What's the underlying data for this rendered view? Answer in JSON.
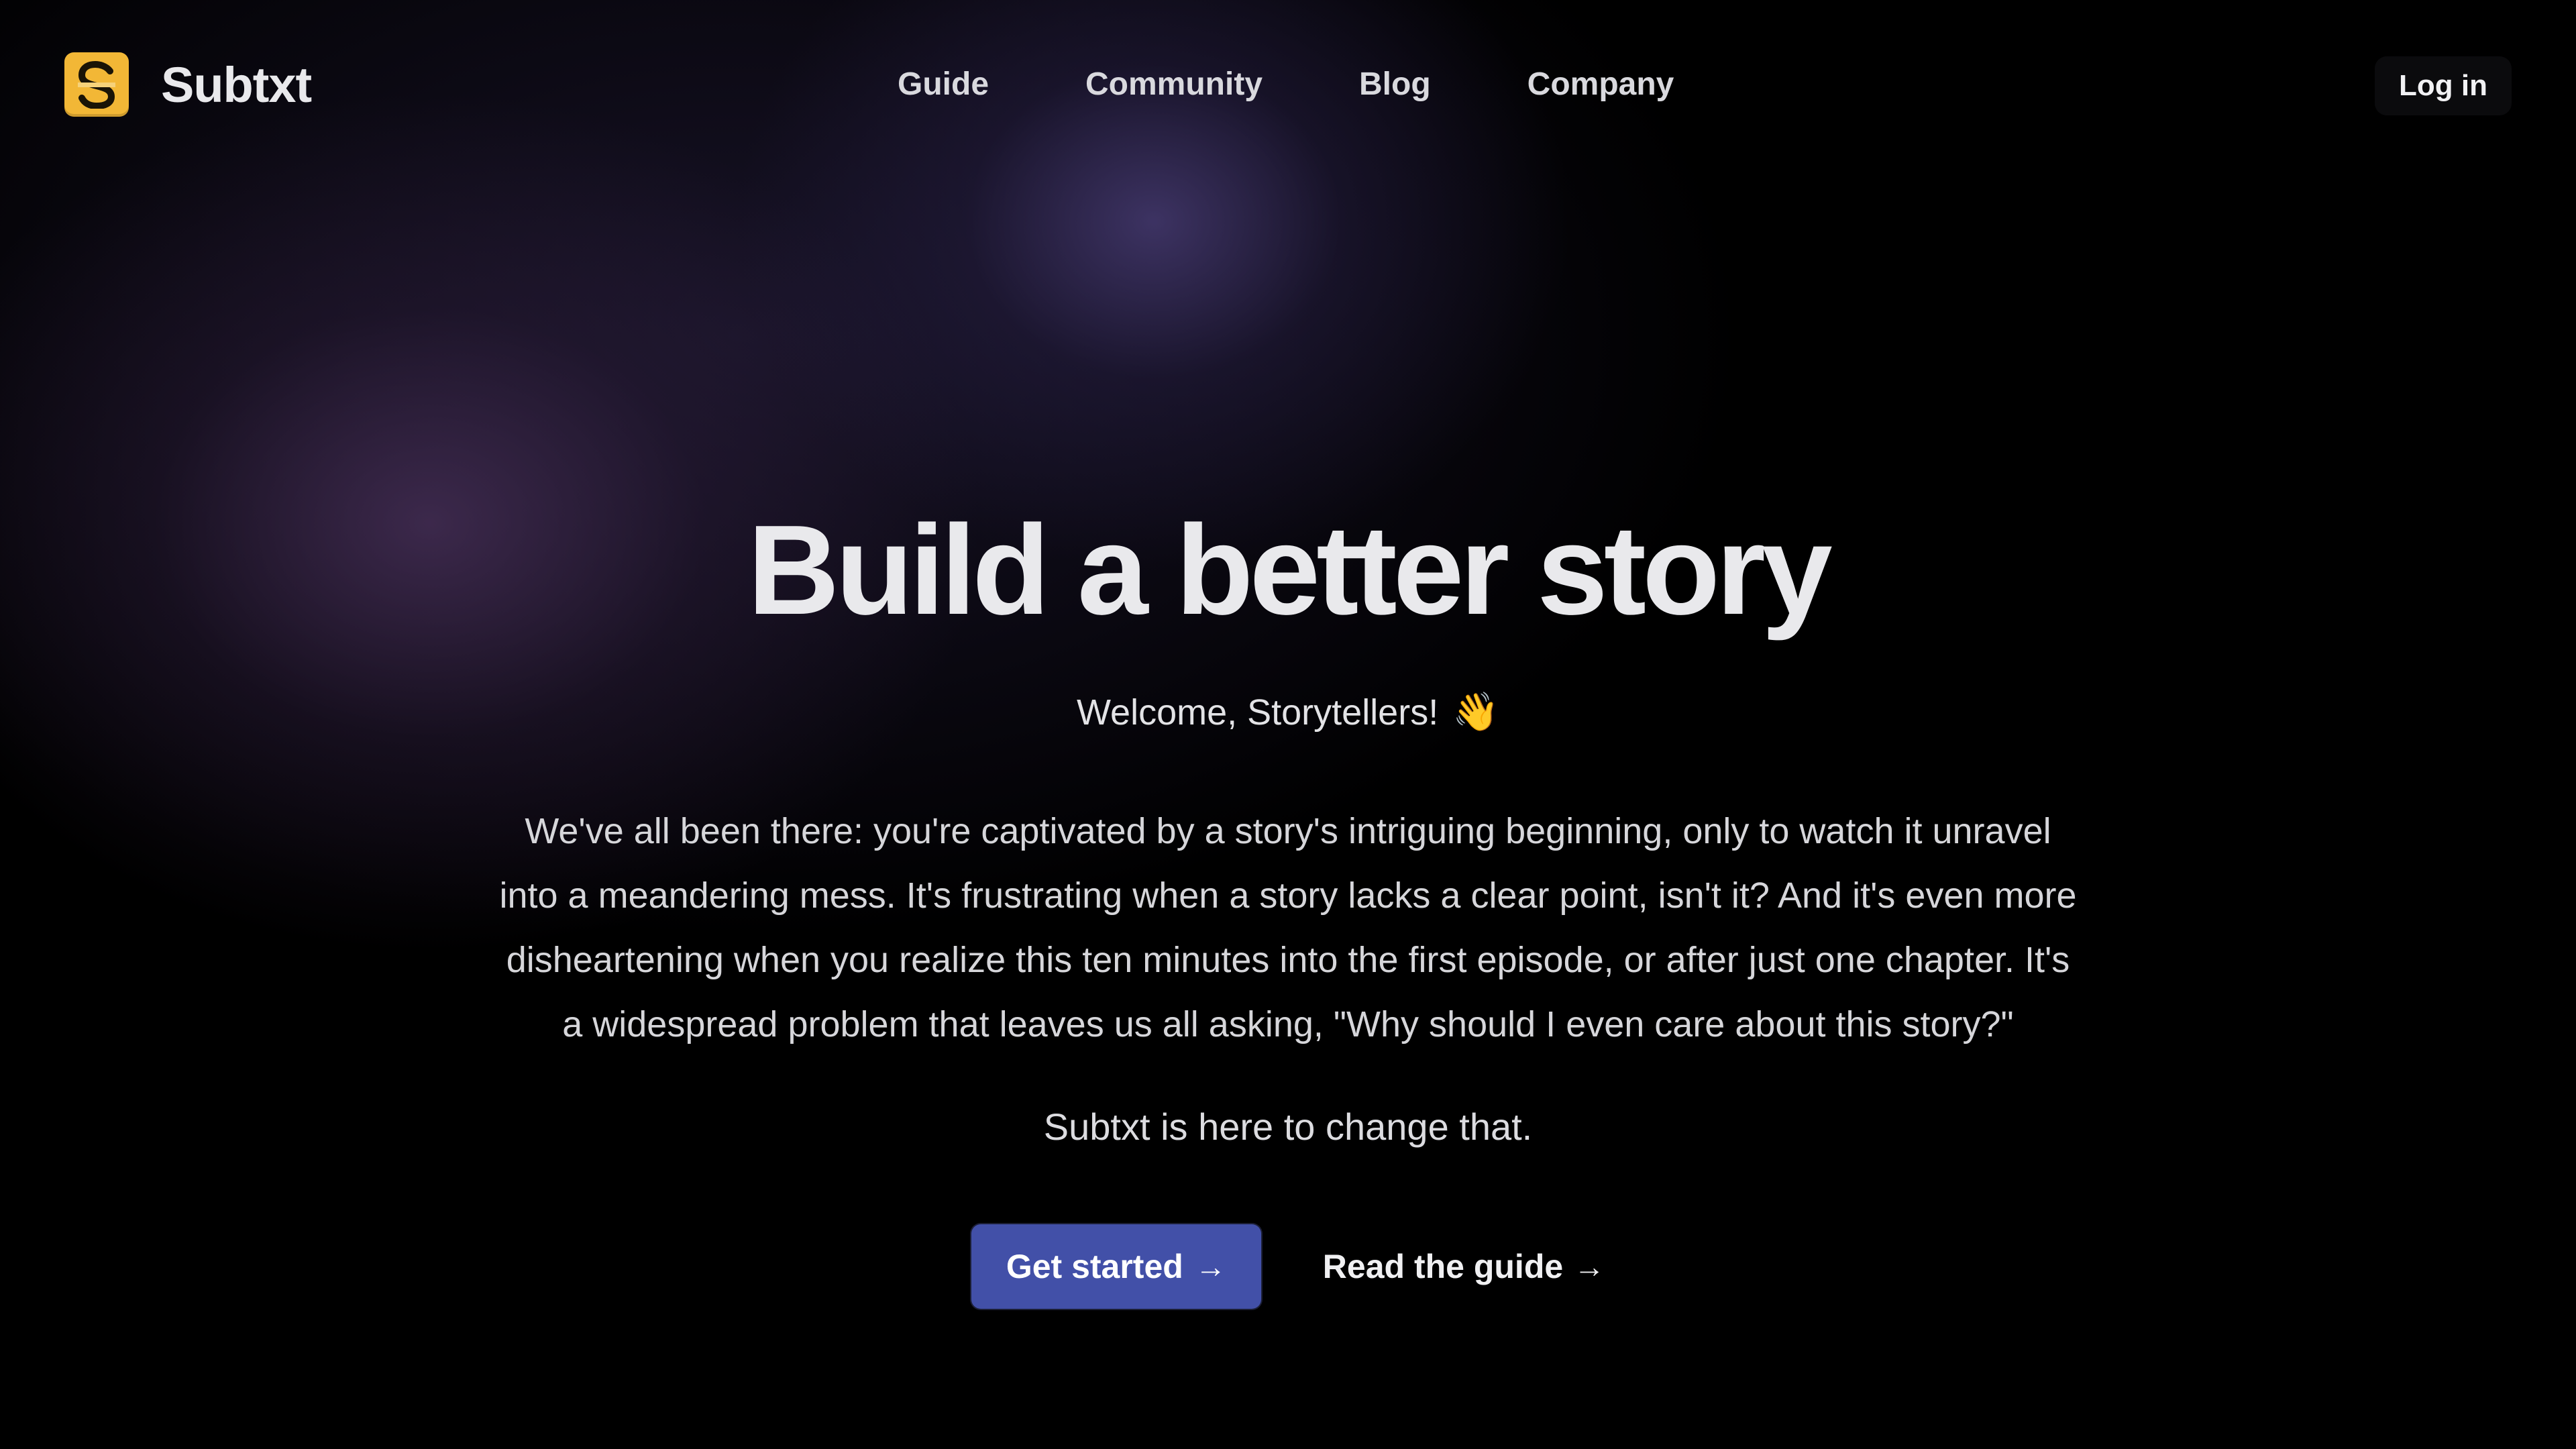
{
  "header": {
    "brand": {
      "logo_letter": "S",
      "logo_color": "#f2b736",
      "name": "Subtxt"
    },
    "nav": [
      {
        "label": "Guide"
      },
      {
        "label": "Community"
      },
      {
        "label": "Blog"
      },
      {
        "label": "Company"
      }
    ],
    "login_label": "Log in"
  },
  "hero": {
    "title": "Build a better story",
    "subtitle": "Welcome, Storytellers!",
    "subtitle_emoji": "👋",
    "body": "We've all been there: you're captivated by a story's intriguing beginning, only to watch it unravel into a meandering mess. It's frustrating when a story lacks a clear point, isn't it? And it's even more disheartening when you realize this ten minutes into the first episode, or after just one chapter. It's a widespread problem that leaves us all asking, \"Why should I even care about this story?\"",
    "tagline": "Subtxt is here to change that.",
    "primary_cta": {
      "label": "Get started",
      "arrow": "→",
      "color": "#4250a8"
    },
    "secondary_cta": {
      "label": "Read the guide",
      "arrow": "→"
    }
  }
}
